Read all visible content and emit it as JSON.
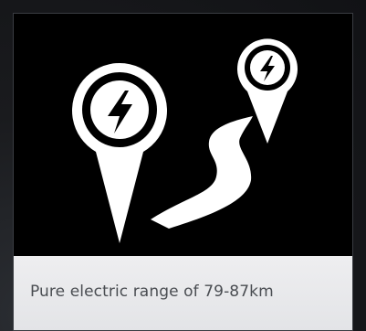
{
  "card": {
    "caption": "Pure electric range of 79-87km"
  },
  "icons": {
    "hero": "electric-range-route-icon",
    "large_pin": "charging-pin-icon",
    "small_pin": "charging-pin-icon",
    "road": "winding-road-icon"
  },
  "colors": {
    "hero_background": "#000000",
    "icon": "#ffffff",
    "caption_background": "#eeeef0",
    "caption_text": "#4a4d52"
  }
}
